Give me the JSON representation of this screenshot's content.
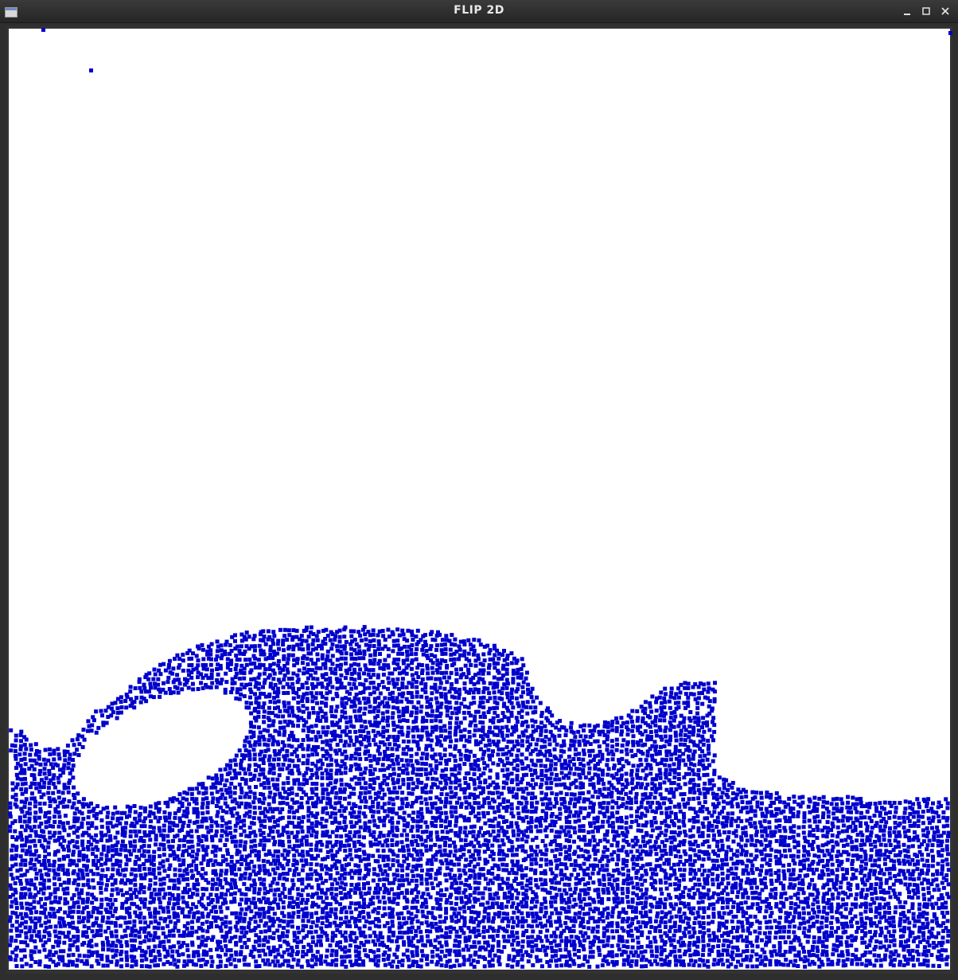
{
  "window": {
    "title": "FLIP 2D",
    "icons": {
      "app": "window-app-icon",
      "minimize": "minimize-icon",
      "maximize": "maximize-icon",
      "close": "close-icon"
    }
  },
  "canvas": {
    "background": "#ffffff",
    "border_color": "#333333",
    "particle_color": "#0000cc"
  }
}
